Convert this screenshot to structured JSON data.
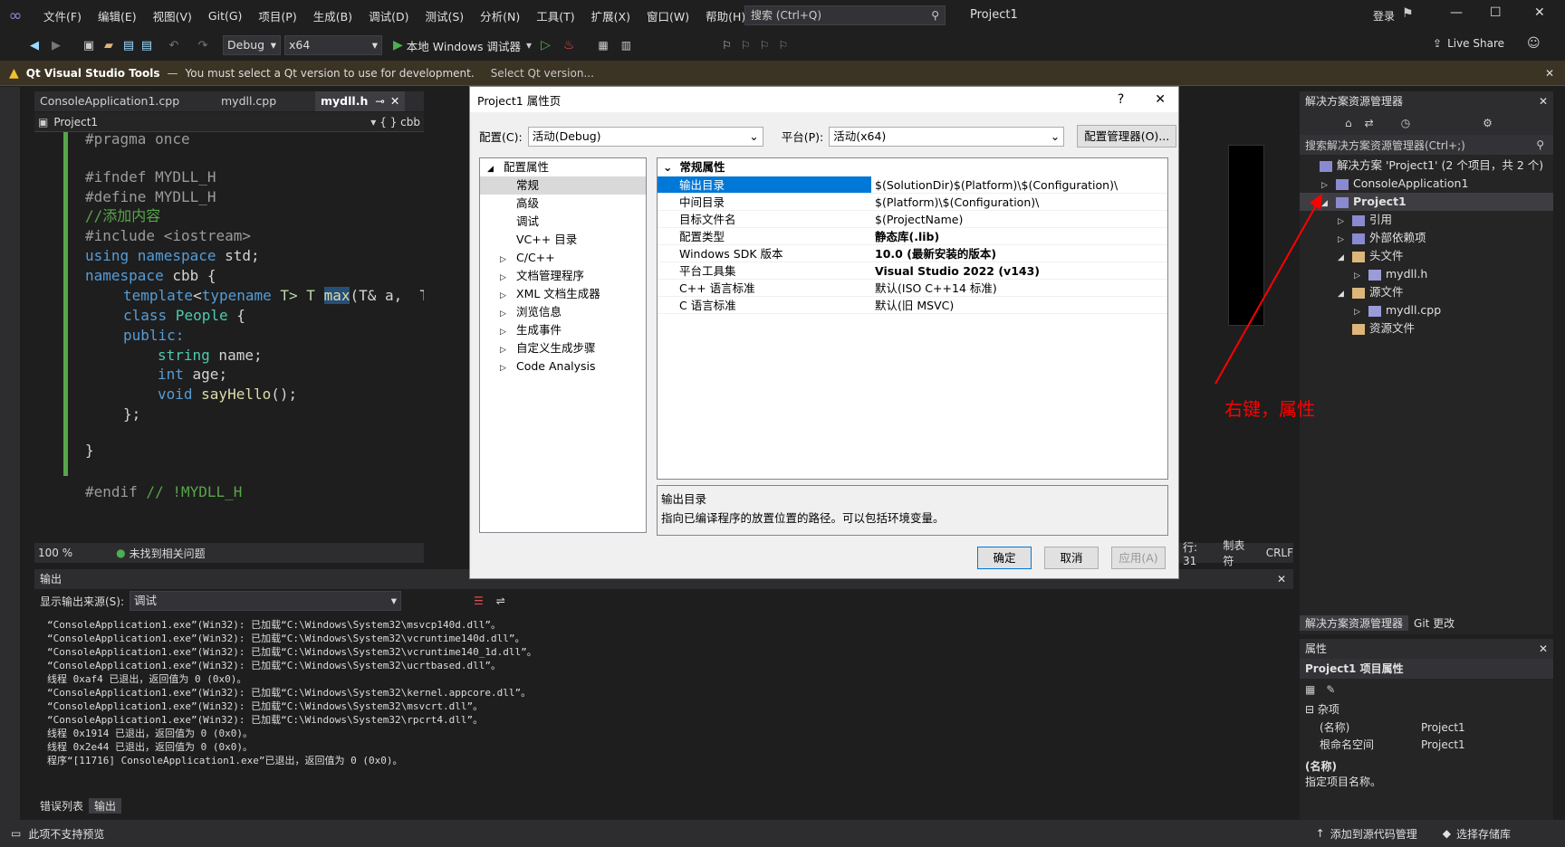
{
  "menu": [
    "文件(F)",
    "编辑(E)",
    "视图(V)",
    "Git(G)",
    "项目(P)",
    "生成(B)",
    "调试(D)",
    "测试(S)",
    "分析(N)",
    "工具(T)",
    "扩展(X)",
    "窗口(W)",
    "帮助(H)"
  ],
  "search": {
    "placeholder": "搜索 (Ctrl+Q)"
  },
  "title": "Project1",
  "login": "登录",
  "toolbar": {
    "config": "Debug",
    "platform": "x64",
    "run": "本地 Windows 调试器",
    "liveshare": "Live Share"
  },
  "qt": {
    "brand": "Qt Visual Studio Tools",
    "dash": "—",
    "msg": "You must select a Qt version to use for development.",
    "link": "Select Qt version..."
  },
  "editor": {
    "tabs": [
      "ConsoleApplication1.cpp",
      "mydll.cpp",
      "mydll.h"
    ],
    "nav_project": "Project1",
    "nav_scope": "{ } cbb",
    "zoom": "100 %",
    "issues": "未找到相关问题",
    "line": "行: 31",
    "tabs_label": "制表符",
    "eol": "CRLF"
  },
  "code": {
    "l1": "#pragma once",
    "l2": "#ifndef MYDLL_H",
    "l3": "#define MYDLL_H",
    "l4": "//添加内容",
    "l5": "#include <iostream>",
    "l6a": "using namespace",
    "l6b": " std;",
    "l7a": "namespace",
    "l7b": " cbb {",
    "l8a": "template",
    "l8b": "<",
    "l8c": "typename",
    "l8d": " T>",
    "l8e": " T ",
    "l8f": "max",
    "l8g": "(T& a,  T& b)",
    "l9a": "class",
    "l9b": " People",
    "l9c": " {",
    "l10": "public:",
    "l11a": "string",
    "l11b": " name;",
    "l12a": "int",
    "l12b": " age;",
    "l13a": "void",
    "l13b": " sayHello",
    "l13c": "();",
    "l14": "};",
    "l15": "}",
    "l16a": "#endif",
    "l16b": " // !MYDLL_H"
  },
  "dialog": {
    "title": "Project1 属性页",
    "help": "?",
    "close": "✕",
    "config_label": "配置(C):",
    "config_value": "活动(Debug)",
    "platform_label": "平台(P):",
    "platform_value": "活动(x64)",
    "config_mgr": "配置管理器(O)...",
    "tree": [
      {
        "label": "配置属性",
        "level": 0,
        "exp": "◢"
      },
      {
        "label": "常规",
        "level": 1,
        "sel": true
      },
      {
        "label": "高级",
        "level": 1
      },
      {
        "label": "调试",
        "level": 1
      },
      {
        "label": "VC++ 目录",
        "level": 1
      },
      {
        "label": "C/C++",
        "level": 1,
        "exp": "▷"
      },
      {
        "label": "文档管理程序",
        "level": 1,
        "exp": "▷"
      },
      {
        "label": "XML 文档生成器",
        "level": 1,
        "exp": "▷"
      },
      {
        "label": "浏览信息",
        "level": 1,
        "exp": "▷"
      },
      {
        "label": "生成事件",
        "level": 1,
        "exp": "▷"
      },
      {
        "label": "自定义生成步骤",
        "level": 1,
        "exp": "▷"
      },
      {
        "label": "Code Analysis",
        "level": 1,
        "exp": "▷"
      }
    ],
    "grid_header": "常规属性",
    "grid": [
      {
        "k": "输出目录",
        "v": "$(SolutionDir)$(Platform)\\$(Configuration)\\",
        "sel": true
      },
      {
        "k": "中间目录",
        "v": "$(Platform)\\$(Configuration)\\"
      },
      {
        "k": "目标文件名",
        "v": "$(ProjectName)"
      },
      {
        "k": "配置类型",
        "v": "静态库(.lib)",
        "b": true
      },
      {
        "k": "Windows SDK 版本",
        "v": "10.0 (最新安装的版本)",
        "b": true
      },
      {
        "k": "平台工具集",
        "v": "Visual Studio 2022 (v143)",
        "b": true
      },
      {
        "k": "C++ 语言标准",
        "v": "默认(ISO C++14 标准)"
      },
      {
        "k": "C 语言标准",
        "v": "默认(旧 MSVC)"
      }
    ],
    "desc_title": "输出目录",
    "desc_text": "指向已编译程序的放置位置的路径。可以包括环境变量。",
    "ok": "确定",
    "cancel": "取消",
    "apply": "应用(A)"
  },
  "solution": {
    "header": "解决方案资源管理器",
    "search": "搜索解决方案资源管理器(Ctrl+;)",
    "items": [
      {
        "label": "解决方案 'Project1' (2 个项目，共 2 个)",
        "indent": 0,
        "icon": "solution-icon",
        "exp": ""
      },
      {
        "label": "ConsoleApplication1",
        "indent": 1,
        "icon": "project-icon",
        "exp": "▷"
      },
      {
        "label": "Project1",
        "indent": 1,
        "icon": "project-icon",
        "exp": "◢",
        "sel": true
      },
      {
        "label": "引用",
        "indent": 2,
        "icon": "references-icon",
        "exp": "▷"
      },
      {
        "label": "外部依赖项",
        "indent": 2,
        "icon": "external-deps-icon",
        "exp": "▷"
      },
      {
        "label": "头文件",
        "indent": 2,
        "icon": "folder-icon",
        "exp": "◢"
      },
      {
        "label": "mydll.h",
        "indent": 3,
        "icon": "header-file-icon",
        "exp": "▷"
      },
      {
        "label": "源文件",
        "indent": 2,
        "icon": "folder-icon",
        "exp": "◢"
      },
      {
        "label": "mydll.cpp",
        "indent": 3,
        "icon": "cpp-file-icon",
        "exp": "▷"
      },
      {
        "label": "资源文件",
        "indent": 2,
        "icon": "folder-icon",
        "exp": ""
      }
    ],
    "tab1": "解决方案资源管理器",
    "tab2": "Git 更改"
  },
  "annotation": "右键，属性",
  "props": {
    "header": "属性",
    "subject": "Project1  项目属性",
    "section": "杂项",
    "rows": [
      {
        "k": "(名称)",
        "v": "Project1"
      },
      {
        "k": "根命名空间",
        "v": "Project1"
      }
    ],
    "desc_title": "(名称)",
    "desc_text": "指定项目名称。"
  },
  "output": {
    "title": "输出",
    "source_label": "显示输出来源(S):",
    "source_value": "调试",
    "lines": [
      "“ConsoleApplication1.exe”(Win32): 已加载“C:\\Windows\\System32\\msvcp140d.dll”。",
      "“ConsoleApplication1.exe”(Win32): 已加载“C:\\Windows\\System32\\vcruntime140d.dll”。",
      "“ConsoleApplication1.exe”(Win32): 已加载“C:\\Windows\\System32\\vcruntime140_1d.dll”。",
      "“ConsoleApplication1.exe”(Win32): 已加载“C:\\Windows\\System32\\ucrtbased.dll”。",
      "线程 0xaf4 已退出，返回值为 0 (0x0)。",
      "“ConsoleApplication1.exe”(Win32): 已加载“C:\\Windows\\System32\\kernel.appcore.dll”。",
      "“ConsoleApplication1.exe”(Win32): 已加载“C:\\Windows\\System32\\msvcrt.dll”。",
      "“ConsoleApplication1.exe”(Win32): 已加载“C:\\Windows\\System32\\rpcrt4.dll”。",
      "线程 0x1914 已退出，返回值为 0 (0x0)。",
      "线程 0x2e44 已退出，返回值为 0 (0x0)。",
      "程序“[11716] ConsoleApplication1.exe”已退出，返回值为 0 (0x0)。"
    ],
    "tab_errors": "错误列表",
    "tab_output": "输出"
  },
  "status": {
    "left": "此项不支持预览",
    "right1": "添加到源代码管理",
    "right2": "选择存储库"
  },
  "colors": {
    "accent": "#007acc",
    "warning": "#f0c030",
    "annotation": "#ff0000"
  }
}
